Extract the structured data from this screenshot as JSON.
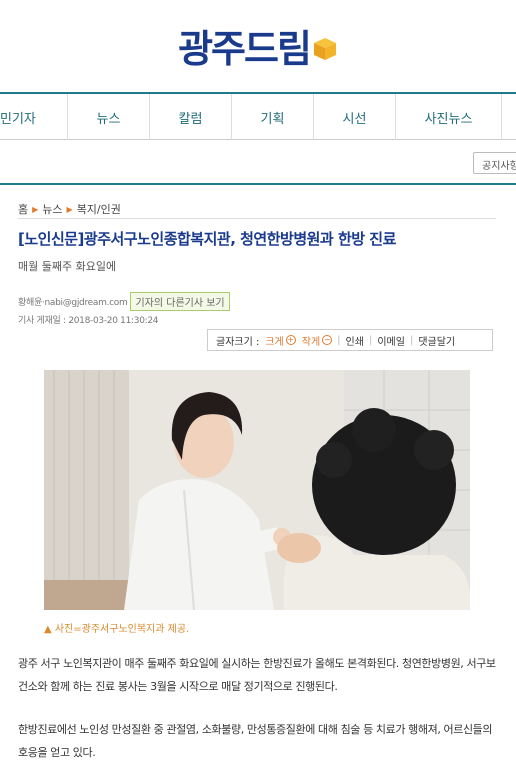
{
  "site": {
    "logo_text": "광주드림"
  },
  "nav": {
    "items": [
      "민기자",
      "뉴스",
      "칼럼",
      "기획",
      "시선",
      "사진뉴스"
    ]
  },
  "notice_button": "공지사항",
  "breadcrumb": [
    "홈",
    "뉴스",
    "복지/인권"
  ],
  "article": {
    "title": "[노인신문]광주서구노인종합복지관, 청연한방병원과 한방 진료",
    "subtitle": "매월 둘째주 화요일에",
    "author": "황해윤·nabi@gjdream.com",
    "other_articles_label": "기자의 다른기사 보기",
    "date": "기사 게재일 : 2018-03-20 11:30:24",
    "caption": "▲ 사진=광주서구노인복지과 제공.",
    "paragraphs": [
      "광주 서구 노인복지관이 매주 둘째주 화요일에 실시하는 한방진료가 올해도 본격화된다. 청연한방병원, 서구보건소와 함께 하는 진료 봉사는 3월을 시작으로 매달 정기적으로 진행된다.",
      "한방진료에선 노인성 만성질환 중 관절염, 소화불량, 만성통증질환에 대해 침술 등 치료가 행해져, 어르신들의 호응을 얻고 있다."
    ]
  },
  "tools": {
    "font_size_label": "글자크기 :",
    "bigger": "크게",
    "smaller": "작게",
    "print": "인쇄",
    "email": "이메일",
    "comment": "댓글달기"
  },
  "colors": {
    "brand": "#1a3a8c",
    "accent": "#e07a2f",
    "teal": "#1f7a8c"
  }
}
